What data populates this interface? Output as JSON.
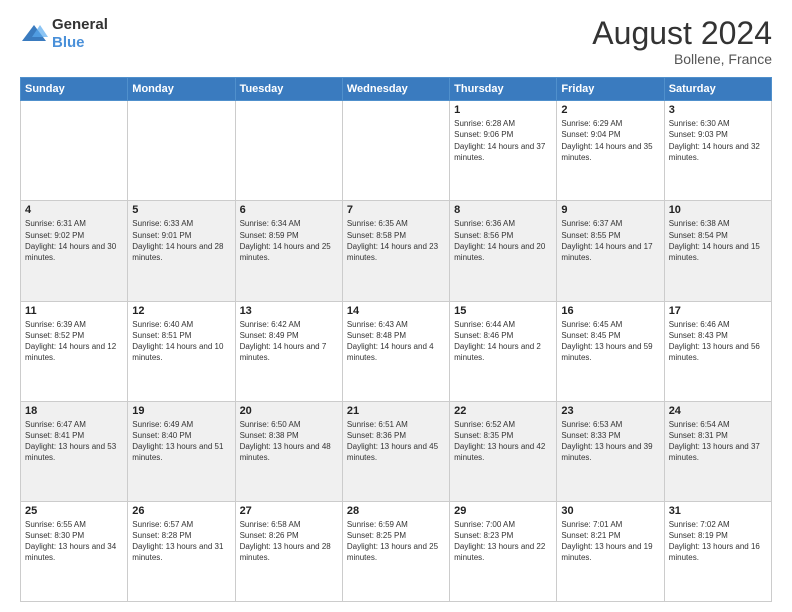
{
  "logo": {
    "general": "General",
    "blue": "Blue"
  },
  "title": {
    "month_year": "August 2024",
    "location": "Bollene, France"
  },
  "days_of_week": [
    "Sunday",
    "Monday",
    "Tuesday",
    "Wednesday",
    "Thursday",
    "Friday",
    "Saturday"
  ],
  "weeks": [
    [
      {
        "day": "",
        "text": ""
      },
      {
        "day": "",
        "text": ""
      },
      {
        "day": "",
        "text": ""
      },
      {
        "day": "",
        "text": ""
      },
      {
        "day": "1",
        "text": "Sunrise: 6:28 AM\nSunset: 9:06 PM\nDaylight: 14 hours and 37 minutes."
      },
      {
        "day": "2",
        "text": "Sunrise: 6:29 AM\nSunset: 9:04 PM\nDaylight: 14 hours and 35 minutes."
      },
      {
        "day": "3",
        "text": "Sunrise: 6:30 AM\nSunset: 9:03 PM\nDaylight: 14 hours and 32 minutes."
      }
    ],
    [
      {
        "day": "4",
        "text": "Sunrise: 6:31 AM\nSunset: 9:02 PM\nDaylight: 14 hours and 30 minutes."
      },
      {
        "day": "5",
        "text": "Sunrise: 6:33 AM\nSunset: 9:01 PM\nDaylight: 14 hours and 28 minutes."
      },
      {
        "day": "6",
        "text": "Sunrise: 6:34 AM\nSunset: 8:59 PM\nDaylight: 14 hours and 25 minutes."
      },
      {
        "day": "7",
        "text": "Sunrise: 6:35 AM\nSunset: 8:58 PM\nDaylight: 14 hours and 23 minutes."
      },
      {
        "day": "8",
        "text": "Sunrise: 6:36 AM\nSunset: 8:56 PM\nDaylight: 14 hours and 20 minutes."
      },
      {
        "day": "9",
        "text": "Sunrise: 6:37 AM\nSunset: 8:55 PM\nDaylight: 14 hours and 17 minutes."
      },
      {
        "day": "10",
        "text": "Sunrise: 6:38 AM\nSunset: 8:54 PM\nDaylight: 14 hours and 15 minutes."
      }
    ],
    [
      {
        "day": "11",
        "text": "Sunrise: 6:39 AM\nSunset: 8:52 PM\nDaylight: 14 hours and 12 minutes."
      },
      {
        "day": "12",
        "text": "Sunrise: 6:40 AM\nSunset: 8:51 PM\nDaylight: 14 hours and 10 minutes."
      },
      {
        "day": "13",
        "text": "Sunrise: 6:42 AM\nSunset: 8:49 PM\nDaylight: 14 hours and 7 minutes."
      },
      {
        "day": "14",
        "text": "Sunrise: 6:43 AM\nSunset: 8:48 PM\nDaylight: 14 hours and 4 minutes."
      },
      {
        "day": "15",
        "text": "Sunrise: 6:44 AM\nSunset: 8:46 PM\nDaylight: 14 hours and 2 minutes."
      },
      {
        "day": "16",
        "text": "Sunrise: 6:45 AM\nSunset: 8:45 PM\nDaylight: 13 hours and 59 minutes."
      },
      {
        "day": "17",
        "text": "Sunrise: 6:46 AM\nSunset: 8:43 PM\nDaylight: 13 hours and 56 minutes."
      }
    ],
    [
      {
        "day": "18",
        "text": "Sunrise: 6:47 AM\nSunset: 8:41 PM\nDaylight: 13 hours and 53 minutes."
      },
      {
        "day": "19",
        "text": "Sunrise: 6:49 AM\nSunset: 8:40 PM\nDaylight: 13 hours and 51 minutes."
      },
      {
        "day": "20",
        "text": "Sunrise: 6:50 AM\nSunset: 8:38 PM\nDaylight: 13 hours and 48 minutes."
      },
      {
        "day": "21",
        "text": "Sunrise: 6:51 AM\nSunset: 8:36 PM\nDaylight: 13 hours and 45 minutes."
      },
      {
        "day": "22",
        "text": "Sunrise: 6:52 AM\nSunset: 8:35 PM\nDaylight: 13 hours and 42 minutes."
      },
      {
        "day": "23",
        "text": "Sunrise: 6:53 AM\nSunset: 8:33 PM\nDaylight: 13 hours and 39 minutes."
      },
      {
        "day": "24",
        "text": "Sunrise: 6:54 AM\nSunset: 8:31 PM\nDaylight: 13 hours and 37 minutes."
      }
    ],
    [
      {
        "day": "25",
        "text": "Sunrise: 6:55 AM\nSunset: 8:30 PM\nDaylight: 13 hours and 34 minutes."
      },
      {
        "day": "26",
        "text": "Sunrise: 6:57 AM\nSunset: 8:28 PM\nDaylight: 13 hours and 31 minutes."
      },
      {
        "day": "27",
        "text": "Sunrise: 6:58 AM\nSunset: 8:26 PM\nDaylight: 13 hours and 28 minutes."
      },
      {
        "day": "28",
        "text": "Sunrise: 6:59 AM\nSunset: 8:25 PM\nDaylight: 13 hours and 25 minutes."
      },
      {
        "day": "29",
        "text": "Sunrise: 7:00 AM\nSunset: 8:23 PM\nDaylight: 13 hours and 22 minutes."
      },
      {
        "day": "30",
        "text": "Sunrise: 7:01 AM\nSunset: 8:21 PM\nDaylight: 13 hours and 19 minutes."
      },
      {
        "day": "31",
        "text": "Sunrise: 7:02 AM\nSunset: 8:19 PM\nDaylight: 13 hours and 16 minutes."
      }
    ]
  ]
}
